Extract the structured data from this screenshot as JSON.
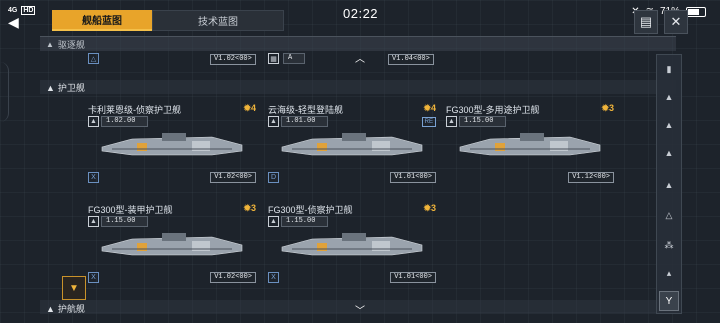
{
  "status_bar": {
    "network": "4G",
    "hd": "HD",
    "time": "02:22",
    "battery": "71%"
  },
  "tabs": [
    {
      "label": "舰船蓝图",
      "active": true
    },
    {
      "label": "技术蓝图",
      "active": false
    }
  ],
  "sections": {
    "top_label": "驱逐舰",
    "frigate_label": "护卫舰",
    "bottom_label": "护航舰"
  },
  "ghost_row": {
    "v1": "V1.02<00>",
    "a": "A",
    "v2": "V1.04<00>"
  },
  "cards": [
    {
      "name": "卡利莱恩级-侦察护卫舰",
      "level": "4",
      "stat": "1.02.00",
      "version": "V1.02<00>",
      "corner": "X",
      "re": ""
    },
    {
      "name": "云海级-轻型登陆舰",
      "level": "4",
      "stat": "1.01.00",
      "version": "V1.01<00>",
      "corner": "D",
      "re": "RE"
    },
    {
      "name": "FG300型-多用途护卫舰",
      "level": "3",
      "stat": "1.15.00",
      "version": "V1.12<00>",
      "corner": "",
      "re": ""
    },
    {
      "name": "FG300型-装甲护卫舰",
      "level": "3",
      "stat": "1.15.00",
      "version": "V1.02<00>",
      "corner": "X",
      "re": ""
    },
    {
      "name": "FG300型-侦察护卫舰",
      "level": "3",
      "stat": "1.15.00",
      "version": "V1.01<00>",
      "corner": "X",
      "re": ""
    }
  ],
  "colors": {
    "accent": "#e8a42a",
    "level": "#f0b43a",
    "panel": "#2a3038"
  }
}
